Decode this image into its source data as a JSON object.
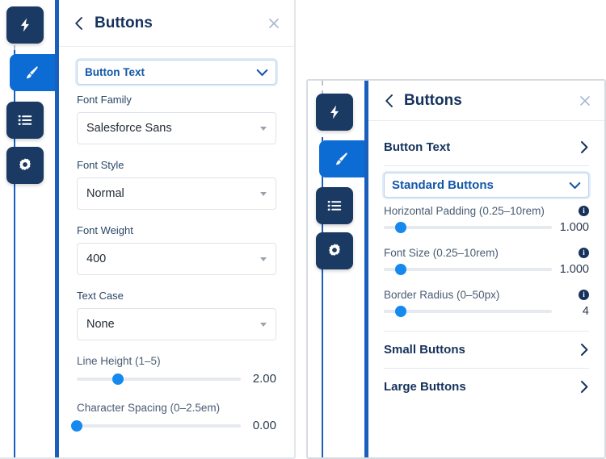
{
  "left_panel": {
    "rail": [
      {
        "icon": "lightning-bolt-icon",
        "name": "rail-item-lightning",
        "active": false
      },
      {
        "icon": "paintbrush-icon",
        "name": "rail-item-theme",
        "active": true
      },
      {
        "icon": "list-icon",
        "name": "rail-item-components",
        "active": false
      },
      {
        "icon": "gear-icon",
        "name": "rail-item-settings",
        "active": false
      }
    ],
    "header": {
      "back_icon": "chevron-left-icon",
      "title": "Buttons",
      "close_icon": "close-icon"
    },
    "accordion_open": {
      "label": "Button Text",
      "chevron": "chevron-down-icon"
    },
    "fields": [
      {
        "label": "Font Family",
        "value": "Salesforce Sans",
        "caret": "caret-down-icon"
      },
      {
        "label": "Font Style",
        "value": "Normal",
        "caret": "caret-down-icon"
      },
      {
        "label": "Font Weight",
        "value": "400",
        "caret": "caret-down-icon"
      },
      {
        "label": "Text Case",
        "value": "None",
        "caret": "caret-down-icon"
      }
    ],
    "sliders": [
      {
        "label": "Line Height (1–5)",
        "value": "2.00",
        "percent": 25,
        "info": false
      },
      {
        "label": "Character Spacing (0–2.5em)",
        "value": "0.00",
        "percent": 0,
        "info": false
      }
    ]
  },
  "right_panel": {
    "rail": [
      {
        "icon": "lightning-bolt-icon",
        "name": "rail-item-lightning",
        "active": false
      },
      {
        "icon": "paintbrush-icon",
        "name": "rail-item-theme",
        "active": true
      },
      {
        "icon": "list-icon",
        "name": "rail-item-components",
        "active": false
      },
      {
        "icon": "gear-icon",
        "name": "rail-item-settings",
        "active": false
      }
    ],
    "header": {
      "back_icon": "chevron-left-icon",
      "title": "Buttons",
      "close_icon": "close-icon"
    },
    "rows_top": [
      {
        "label": "Button Text",
        "chevron": "chevron-right-icon"
      }
    ],
    "accordion_open": {
      "label": "Standard Buttons",
      "chevron": "chevron-down-icon"
    },
    "sliders": [
      {
        "label": "Horizontal Padding (0.25–10rem)",
        "value": "1.000",
        "percent": 10,
        "info": true,
        "info_glyph": "i"
      },
      {
        "label": "Font Size (0.25–10rem)",
        "value": "1.000",
        "percent": 10,
        "info": true,
        "info_glyph": "i"
      },
      {
        "label": "Border Radius (0–50px)",
        "value": "4",
        "percent": 10,
        "info": true,
        "info_glyph": "i"
      }
    ],
    "rows_bottom": [
      {
        "label": "Small Buttons",
        "chevron": "chevron-right-icon"
      },
      {
        "label": "Large Buttons",
        "chevron": "chevron-right-icon"
      }
    ]
  },
  "colors": {
    "navy": "#16325c",
    "rail_navy": "#1b3a63",
    "active_blue": "#0d6bd4",
    "accent_blue": "#1b5fbd",
    "slider_blue": "#1589ee",
    "link_blue": "#1257a8"
  }
}
